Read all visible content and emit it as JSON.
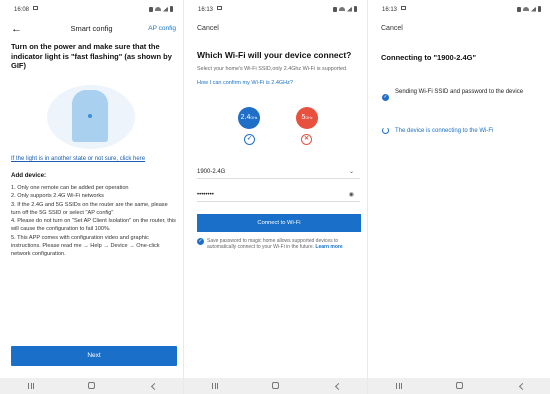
{
  "panel1": {
    "status": {
      "time": "16:08"
    },
    "title": "Smart config",
    "ap_config": "AP config",
    "heading": "Turn on the power and make sure that the indicator light is \"fast flashing\" (as shown by GIF)",
    "other_state_link": "If the light is in another state or not sure, click here",
    "add_device": "Add device:",
    "rules": [
      "1. Only one remote can be added per operation",
      "2. Only supports 2.4G Wi-Fi networks",
      "3. If the 2.4G and 5G SSIDs on the router are the same, please turn off the 5G SSID or select \"AP config\"",
      "4. Please do not turn on \"Set AP Client Isolation\" on the router, this will cause the configuration to fail 100%.",
      "5. This APP comes with configuration video and graphic instructions. Please read me → Help → Device → One-click network configuration."
    ],
    "next_button": "Next"
  },
  "panel2": {
    "status": {
      "time": "16:13"
    },
    "cancel": "Cancel",
    "heading": "Which Wi-Fi will your device connect?",
    "subtext": "Select your home's Wi-Fi SSID,only 2.4Ghz Wi-Fi is supported.",
    "confirm_link": "How I can confirm my Wi-Fi is 2.4GHz?",
    "band_24": {
      "value": "2.4",
      "unit": "GHz"
    },
    "band_5": {
      "value": "5",
      "unit": "GHz"
    },
    "ssid": "1900-2.4G",
    "password_masked": "••••••••",
    "connect_button": "Connect to Wi-Fi",
    "save_text": "Save password to magic home allows supported devices to automatically connect to your Wi-Fi in the future.",
    "learn_more": "Learn more"
  },
  "panel3": {
    "status": {
      "time": "16:13"
    },
    "cancel": "Cancel",
    "heading": "Connecting to \"1900-2.4G\"",
    "step1": "Sending Wi-Fi SSID and password to the device",
    "step2": "The device is connecting to the Wi-Fi"
  },
  "nav": {
    "recent": "|||",
    "home": "○",
    "back": "<"
  }
}
